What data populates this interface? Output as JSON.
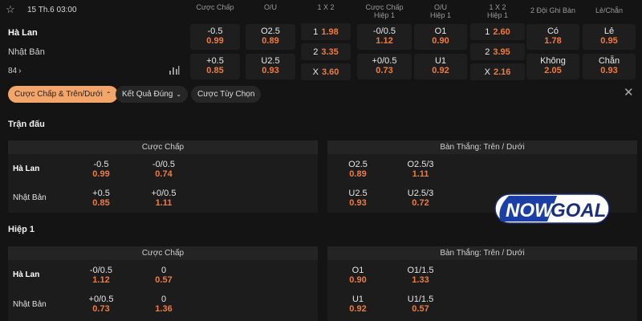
{
  "header": {
    "date": "15 Th.6 03:00",
    "columns": [
      {
        "line1": "Cược Chấp",
        "line2": ""
      },
      {
        "line1": "O/U",
        "line2": ""
      },
      {
        "line1": "1 X 2",
        "line2": ""
      },
      {
        "line1": "Cược Chấp",
        "line2": "Hiệp 1"
      },
      {
        "line1": "O/U",
        "line2": "Hiệp 1"
      },
      {
        "line1": "1 X 2",
        "line2": "Hiệp 1"
      },
      {
        "line1": "2 Đội Ghi Bàn",
        "line2": ""
      },
      {
        "line1": "Lẻ/Chẵn",
        "line2": ""
      }
    ]
  },
  "match": {
    "team1": "Hà Lan",
    "team2": "Nhật Bản",
    "minute": "84",
    "minute_arrow": "›"
  },
  "odds": {
    "handicap": [
      {
        "t": "-0.5",
        "o": "0.99"
      },
      {
        "t": "+0.5",
        "o": "0.85"
      }
    ],
    "ou": [
      {
        "t": "O2.5",
        "o": "0.89"
      },
      {
        "t": "U2.5",
        "o": "0.93"
      }
    ],
    "x12": [
      {
        "t": "1",
        "o": "1.98"
      },
      {
        "t": "2",
        "o": "3.35"
      },
      {
        "t": "X",
        "o": "3.60"
      }
    ],
    "handicap_h1": [
      {
        "t": "-0/0.5",
        "o": "1.12"
      },
      {
        "t": "+0/0.5",
        "o": "0.73"
      }
    ],
    "ou_h1": [
      {
        "t": "O1",
        "o": "0.90"
      },
      {
        "t": "U1",
        "o": "0.92"
      }
    ],
    "x12_h1": [
      {
        "t": "1",
        "o": "2.60"
      },
      {
        "t": "2",
        "o": "3.95"
      },
      {
        "t": "X",
        "o": "2.16"
      }
    ],
    "btts": [
      {
        "t": "Có",
        "o": "1.78"
      },
      {
        "t": "Không",
        "o": "2.05"
      }
    ],
    "oddeven": [
      {
        "t": "Lẻ",
        "o": "0.95"
      },
      {
        "t": "Chẵn",
        "o": "0.93"
      }
    ]
  },
  "tabs": [
    {
      "label": "Cược Chấp & Trên/Dưới",
      "chevron": "⌃"
    },
    {
      "label": "Kết Quả Đúng",
      "chevron": "⌄"
    },
    {
      "label": "Cược Tùy Chọn",
      "chevron": ""
    }
  ],
  "close_icon": "✕",
  "sections": [
    {
      "title": "Trận đấu",
      "left_header": "Cược Chấp",
      "right_header": "Bàn Thắng: Trên / Dưới",
      "rows": [
        {
          "label": "Hà Lan",
          "left": [
            {
              "t": "-0.5",
              "o": "0.99"
            },
            {
              "t": "-0/0.5",
              "o": "0.74"
            }
          ],
          "right": [
            {
              "t": "O2.5",
              "o": "0.89"
            },
            {
              "t": "O2.5/3",
              "o": "1.11"
            }
          ]
        },
        {
          "label": "Nhật Bản",
          "left": [
            {
              "t": "+0.5",
              "o": "0.85"
            },
            {
              "t": "+0/0.5",
              "o": "1.11"
            }
          ],
          "right": [
            {
              "t": "U2.5",
              "o": "0.93"
            },
            {
              "t": "U2.5/3",
              "o": "0.72"
            }
          ]
        }
      ]
    },
    {
      "title": "Hiệp 1",
      "left_header": "Cược Chấp",
      "right_header": "Bàn Thắng: Trên / Dưới",
      "rows": [
        {
          "label": "Hà Lan",
          "left": [
            {
              "t": "-0/0.5",
              "o": "1.12"
            },
            {
              "t": "0",
              "o": "0.57"
            }
          ],
          "right": [
            {
              "t": "O1",
              "o": "0.90"
            },
            {
              "t": "O1/1.5",
              "o": "1.33"
            }
          ]
        },
        {
          "label": "Nhật Bản",
          "left": [
            {
              "t": "+0/0.5",
              "o": "0.73"
            },
            {
              "t": "0",
              "o": "1.36"
            }
          ],
          "right": [
            {
              "t": "U1",
              "o": "0.92"
            },
            {
              "t": "U1/1.5",
              "o": "0.57"
            }
          ]
        }
      ]
    }
  ],
  "logo": {
    "part1": "NOW",
    "part2": "GOAL"
  },
  "colors": {
    "odds": "#f07b3f",
    "tab_active": "#f4a56a",
    "background": "#141414"
  }
}
